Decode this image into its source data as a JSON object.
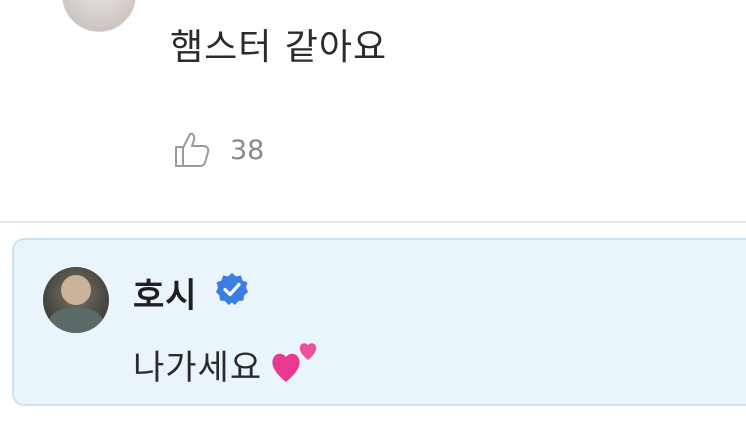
{
  "top_comment": {
    "text": "햄스터 같아요",
    "like_count": "38"
  },
  "pinned_reply": {
    "author": "호시",
    "verified": true,
    "text": "나가세요",
    "emoji": "two-hearts-icon",
    "background_color": "#eaf4fb",
    "border_color": "#cfe2ef",
    "verified_color": "#3b7de0"
  }
}
